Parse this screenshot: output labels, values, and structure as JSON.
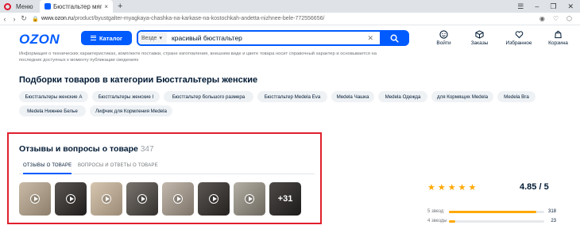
{
  "browser": {
    "menu_label": "Меню",
    "tab_title": "Бюстгальтер мягкая чаш",
    "tab_close": "×",
    "new_tab": "+",
    "url_domain": "www.ozon.ru",
    "url_path": "/product/byustgalter-myagkaya-chashka-na-karkase-na-kostochkah-andetta-nizhnee-bele-772556656/"
  },
  "header": {
    "logo": "OZON",
    "catalog_label": "Каталог",
    "search_scope": "Везде",
    "search_value": "красивый бюстгальтер",
    "nav": [
      {
        "label": "Войти",
        "icon": "smile-icon"
      },
      {
        "label": "Заказы",
        "icon": "box-icon"
      },
      {
        "label": "Избранное",
        "icon": "heart-icon"
      },
      {
        "label": "Корзина",
        "icon": "cart-icon"
      }
    ]
  },
  "info_text": "Информация о технических характеристиках, комплекте поставки, стране изготовления, внешнем виде и цвете товара носит справочный характер и основывается на последних доступных к моменту публикации сведениях",
  "collections": {
    "title": "Подборки товаров в категории Бюстгальтеры женские",
    "chips": [
      "Бюстгальтеры женские А",
      "Бюстгальтеры женские I",
      "Бюстгальтер большого размера",
      "Бюстгальтер Medela Eva",
      "Medela Чашка",
      "Medela Одежда",
      "для Кормящих Medela",
      "Medela Bra",
      "Medela Нижнее Белье",
      "Лифчик для Кормления Medela"
    ]
  },
  "reviews": {
    "title": "Отзывы и вопросы о товаре",
    "count": "347",
    "tabs": [
      "ОТЗЫВЫ О ТОВАРЕ",
      "ВОПРОСЫ И ОТВЕТЫ О ТОВАРЕ"
    ],
    "more_label": "+31",
    "thumb_colors": [
      "#a89a86",
      "#2c2a29",
      "#b9a58e",
      "#4a4744",
      "#9f958a",
      "#3a3633",
      "#8e8a80",
      "#2f2d2c"
    ]
  },
  "rating": {
    "value": "4.85 / 5",
    "stars": 5,
    "rows": [
      {
        "label": "5 звезд",
        "count": "318",
        "fraction": 0.92
      },
      {
        "label": "4 звезды",
        "count": "23",
        "fraction": 0.07
      }
    ]
  },
  "colors": {
    "accent": "#005bff",
    "highlight": "#e0202c",
    "star": "#ffa800"
  }
}
